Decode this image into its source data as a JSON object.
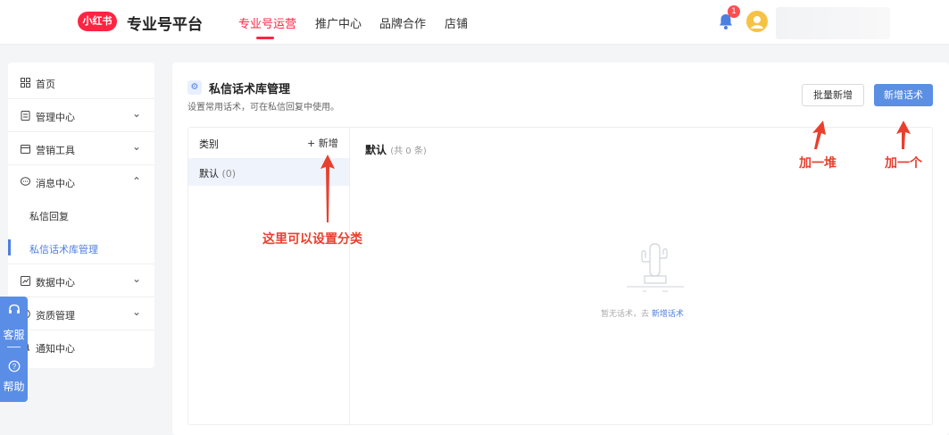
{
  "header": {
    "logo_text": "小红书",
    "brand": "专业号平台",
    "nav": [
      "专业号运营",
      "推广中心",
      "品牌合作",
      "店铺"
    ],
    "notification_count": "1"
  },
  "sidebar": {
    "items": [
      {
        "label": "首页",
        "icon": "grid-icon"
      },
      {
        "label": "管理中心",
        "icon": "doc-icon"
      },
      {
        "label": "营销工具",
        "icon": "calendar-icon"
      },
      {
        "label": "消息中心",
        "icon": "chat-icon"
      },
      {
        "label": "私信回复"
      },
      {
        "label": "私信话术库管理"
      },
      {
        "label": "数据中心",
        "icon": "chart-icon"
      },
      {
        "label": "资质管理",
        "icon": "badge-icon"
      },
      {
        "label": "通知中心",
        "icon": "bell-icon"
      }
    ]
  },
  "float_service": {
    "service": "客服",
    "help": "帮助"
  },
  "page": {
    "title": "私信话术库管理",
    "subtitle": "设置常用话术，可在私信回复中使用。",
    "batch_add": "批量新增",
    "add_script": "新增话术"
  },
  "category": {
    "header": "类别",
    "add": "+ 新增",
    "rows": [
      {
        "name": "默认",
        "count": "(0)"
      }
    ]
  },
  "list": {
    "title": "默认",
    "count": "(共 0 条)",
    "empty_text": "暂无话术，去",
    "empty_link": "新增话术"
  },
  "annotations": {
    "category_hint": "这里可以设置分类",
    "batch_hint": "加一堆",
    "single_hint": "加一个"
  },
  "colors": {
    "brand": "#ff2442",
    "accent": "#4c7fe0",
    "annotation": "#e8402e"
  }
}
